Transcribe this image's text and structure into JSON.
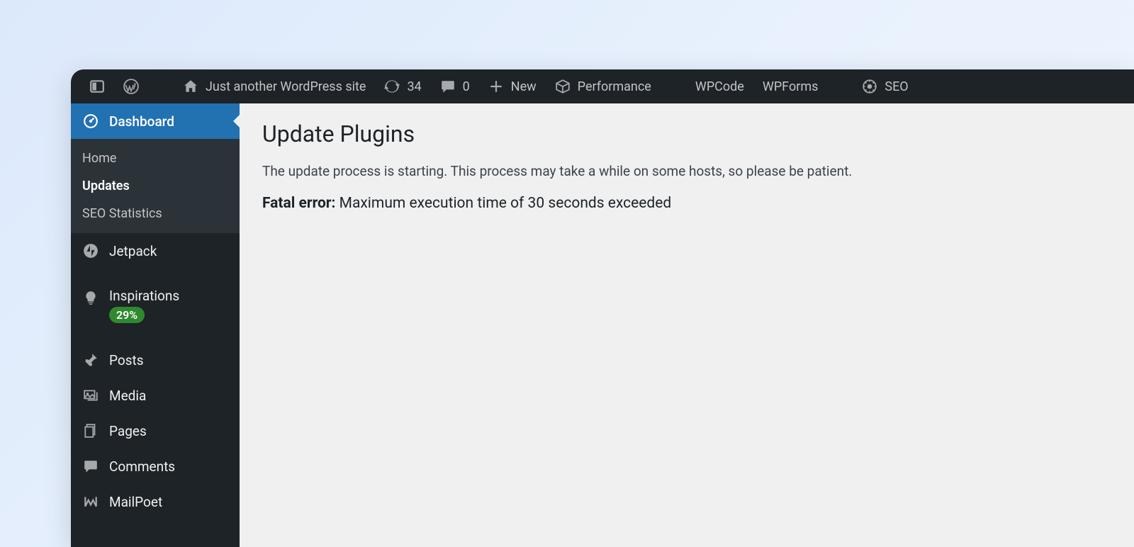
{
  "adminbar": {
    "site_title": "Just another WordPress site",
    "updates_count": "34",
    "comments_count": "0",
    "new_label": "New",
    "performance_label": "Performance",
    "wpcode_label": "WPCode",
    "wpforms_label": "WPForms",
    "seo_label": "SEO"
  },
  "sidebar": {
    "dashboard": "Dashboard",
    "submenu": {
      "home": "Home",
      "updates": "Updates",
      "seo_stats": "SEO Statistics"
    },
    "jetpack": "Jetpack",
    "inspirations": "Inspirations",
    "inspirations_badge": "29%",
    "posts": "Posts",
    "media": "Media",
    "pages": "Pages",
    "comments": "Comments",
    "mailpoet": "MailPoet"
  },
  "content": {
    "title": "Update Plugins",
    "notice": "The update process is starting. This process may take a while on some hosts, so please be patient.",
    "error_label": "Fatal error:",
    "error_message": "Maximum execution time of 30 seconds exceeded"
  }
}
